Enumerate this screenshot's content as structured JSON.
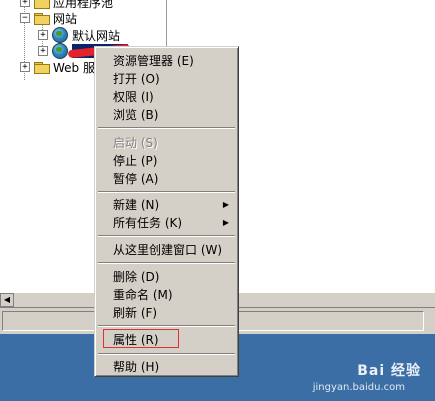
{
  "tree": {
    "items": [
      {
        "label": "应用程序池"
      },
      {
        "label": "网站"
      },
      {
        "label": "默认网站"
      },
      {
        "label": ""
      },
      {
        "label": "Web 服务"
      }
    ]
  },
  "menu": {
    "items": [
      {
        "label": "资源管理器 (E)",
        "enabled": true
      },
      {
        "label": "打开 (O)",
        "enabled": true
      },
      {
        "label": "权限 (I)",
        "enabled": true
      },
      {
        "label": "浏览 (B)",
        "enabled": true
      },
      {
        "label": "启动 (S)",
        "enabled": false
      },
      {
        "label": "停止 (P)",
        "enabled": true
      },
      {
        "label": "暂停 (A)",
        "enabled": true
      },
      {
        "label": "新建 (N)",
        "enabled": true,
        "submenu": true
      },
      {
        "label": "所有任务 (K)",
        "enabled": true,
        "submenu": true
      },
      {
        "label": "从这里创建窗口 (W)",
        "enabled": true
      },
      {
        "label": "删除 (D)",
        "enabled": true
      },
      {
        "label": "重命名 (M)",
        "enabled": true
      },
      {
        "label": "刷新 (F)",
        "enabled": true
      },
      {
        "label": "属性 (R)",
        "enabled": true
      },
      {
        "label": "帮助 (H)",
        "enabled": true
      }
    ]
  },
  "watermark": {
    "text": "Bai 经验",
    "url": "jingyan.baidu.com"
  },
  "colors": {
    "desktop": "#3a6ea5",
    "menu_bg": "#d4d0c8",
    "highlight_box": "#e0302f",
    "selection": "#0a246a"
  }
}
